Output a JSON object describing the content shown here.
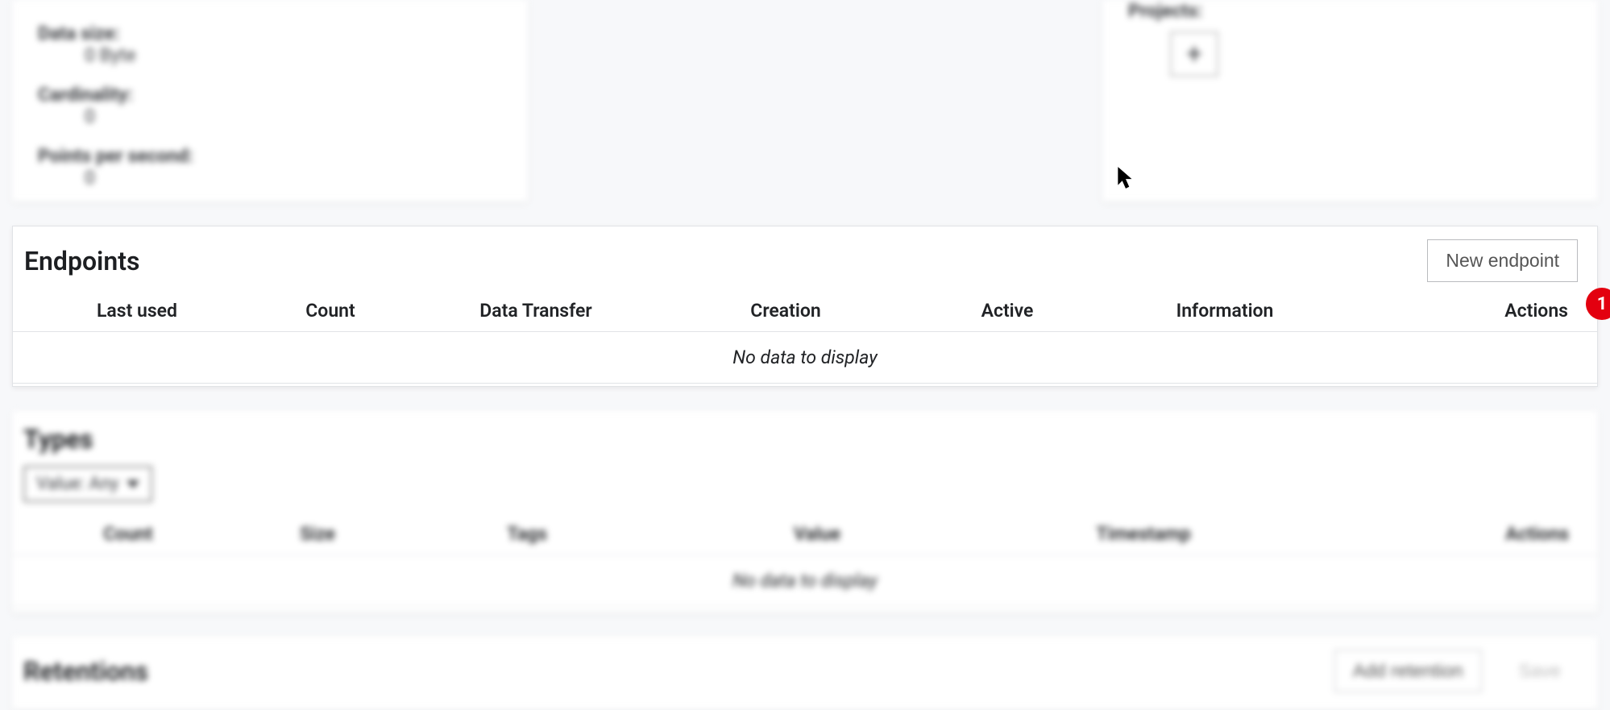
{
  "stats": {
    "data_label": "Data size:",
    "data_value": "0 Byte",
    "cardinality_label": "Cardinality:",
    "cardinality_value": "0",
    "pps_label": "Points per second:",
    "pps_value": "0"
  },
  "projects": {
    "label": "Projects:"
  },
  "endpoints": {
    "title": "Endpoints",
    "new_button": "New endpoint",
    "columns": {
      "last_used": "Last used",
      "count": "Count",
      "data_transfer": "Data Transfer",
      "creation": "Creation",
      "active": "Active",
      "information": "Information",
      "actions": "Actions"
    },
    "empty": "No data to display"
  },
  "types": {
    "title": "Types",
    "filter_label": "Value: Any",
    "columns": {
      "count": "Count",
      "size": "Size",
      "tags": "Tags",
      "value": "Value",
      "timestamp": "Timestamp",
      "actions": "Actions"
    },
    "empty": "No data to display"
  },
  "retentions": {
    "title": "Retentions",
    "add_button": "Add retention",
    "save_button": "Save"
  },
  "annotation": {
    "badge": "1"
  }
}
